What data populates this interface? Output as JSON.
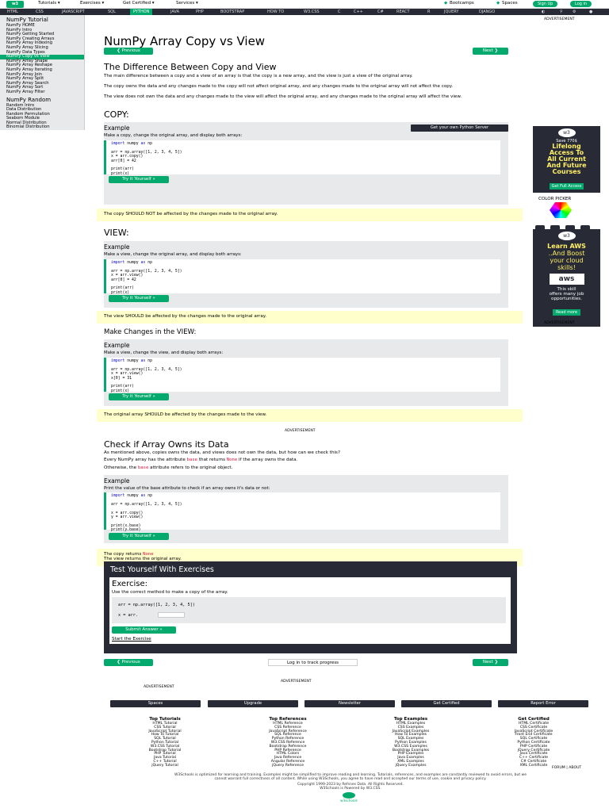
{
  "topbar": {
    "menu": [
      "Tutorials ▾",
      "Exercises ▾",
      "Get Certified ▾",
      "Services ▾"
    ],
    "bootcamp": "Bootcamps",
    "spaces": "Spaces",
    "signup": "Sign Up",
    "login": "Log in"
  },
  "nav": [
    "HTML",
    "CSS",
    "JAVASCRIPT",
    "SQL",
    "PYTHON",
    "JAVA",
    "PHP",
    "BOOTSTRAP",
    "HOW TO",
    "W3.CSS",
    "C",
    "C++",
    "C#",
    "REACT",
    "R",
    "JQUERY",
    "DJANGO"
  ],
  "sidebar": {
    "heading1": "NumPy Tutorial",
    "items1": [
      "NumPy HOME",
      "NumPy Intro",
      "NumPy Getting Started",
      "NumPy Creating Arrays",
      "NumPy Array Indexing",
      "NumPy Array Slicing",
      "NumPy Data Types",
      "NumPy Copy vs View",
      "NumPy Array Shape",
      "NumPy Array Reshape",
      "NumPy Array Iterating",
      "NumPy Array Join",
      "NumPy Array Split",
      "NumPy Array Search",
      "NumPy Array Sort",
      "NumPy Array Filter"
    ],
    "heading2": "NumPy Random",
    "items2": [
      "Random Intro",
      "Data Distribution",
      "Random Permutation",
      "Seaborn Module",
      "Normal Distribution",
      "Binomial Distribution"
    ]
  },
  "main": {
    "title": "NumPy Array Copy vs View",
    "prev": "❮ Previous",
    "next": "Next ❯",
    "diff_heading": "The Difference Between Copy and View",
    "diff_p1": "The main difference between a copy and a view of an array is that the copy is a new array, and the view is just a view of the original array.",
    "diff_p2": "The copy owns the data and any changes made to the copy will not affect original array, and any changes made to the original array will not affect the copy.",
    "diff_p3": "The view does not own the data and any changes made to the view will affect the original array, and any changes made to the original array will affect the view.",
    "copy_heading": "COPY:",
    "example_label": "Example",
    "server_btn": "Get your own Python Server",
    "copy_desc": "Make a copy, change the original array, and display both arrays:",
    "try_btn": "Try it Yourself »",
    "copy_note": "The copy SHOULD NOT be affected by the changes made to the original array.",
    "view_heading": "VIEW:",
    "view_desc": "Make a view, change the original array, and display both arrays:",
    "view_note": "The view SHOULD be affected by the changes made to the original array.",
    "mc_heading": "Make Changes in the VIEW:",
    "mc_desc": "Make a view, change the view, and display both arrays:",
    "mc_note": "The original array SHOULD be affected by the changes made to the view.",
    "advert": "ADVERTISEMENT",
    "own_heading": "Check if Array Owns its Data",
    "own_p1": "As mentioned above, copies owns the data, and views does not own the data, but how can we check this?",
    "own_p2a": "Every NumPy array has the attribute",
    "own_p2_base": "base",
    "own_p2b": "that returns",
    "own_p2_none": "None",
    "own_p2c": "if the array owns the data.",
    "own_p3a": "Otherwise, the",
    "own_p3b": "attribute refers to the original object.",
    "own_desc": "Print the value of the base attribute to check if an array owns it's data or not:",
    "own_note1a": "The copy returns",
    "own_note1_none": "None",
    "own_note2": "The view returns the original array.",
    "track_btn": "Log in to track progress"
  },
  "code": {
    "import": "import",
    "numpy_as": " numpy ",
    "as": "as",
    "np": " np",
    "copy": [
      "arr = np.array([1, 2, 3, 4, 5])",
      "x = arr.copy()",
      "arr[0] = 42",
      "",
      "print(arr)",
      "print(x)"
    ],
    "view": [
      "arr = np.array([1, 2, 3, 4, 5])",
      "x = arr.view()",
      "arr[0] = 42",
      "",
      "print(arr)",
      "print(x)"
    ],
    "mc": [
      "arr = np.array([1, 2, 3, 4, 5])",
      "x = arr.view()",
      "x[0] = 31",
      "",
      "print(arr)",
      "print(x)"
    ],
    "own": [
      "arr = np.array([1, 2, 3, 4, 5])",
      "",
      "x = arr.copy()",
      "y = arr.view()",
      "",
      "print(x.base)",
      "print(y.base)"
    ]
  },
  "exercise": {
    "heading": "Test Yourself With Exercises",
    "label": "Exercise:",
    "desc": "Use the correct method to make a copy of the array.",
    "line1": "arr = np.array([1, 2, 3, 4, 5])",
    "line2": "x = arr.",
    "submit": "Submit Answer »",
    "start": "Start the Exercise"
  },
  "right": {
    "advert": "ADVERTISEMENT",
    "ad1_line1": "Save 770$",
    "ad1_line2": "Lifelong",
    "ad1_line3": "Access To",
    "ad1_line4": "All Current",
    "ad1_line5": "And Future",
    "ad1_line6": "Courses",
    "ad1_btn": "Get Full Access",
    "color_picker": "COLOR PICKER",
    "ad2_line1": "Learn AWS",
    "ad2_line2": "..And Boost",
    "ad2_line3": "your cloud",
    "ad2_line4": "skills!",
    "ad2_aws": "aws",
    "ad2_line5": "This skill",
    "ad2_line6": "offers many job",
    "ad2_line7": "opportunities.",
    "ad2_btn": "Read more",
    "advert2": "ADVERTISEMENT"
  },
  "footer": {
    "advert": "ADVERTISEMENT",
    "advert2": "ADVERTISEMENT",
    "buttons": [
      "Spaces",
      "Upgrade",
      "Newsletter",
      "Get Certified",
      "Report Error"
    ],
    "cols": [
      {
        "title": "Top Tutorials",
        "items": [
          "HTML Tutorial",
          "CSS Tutorial",
          "JavaScript Tutorial",
          "How To Tutorial",
          "SQL Tutorial",
          "Python Tutorial",
          "W3.CSS Tutorial",
          "Bootstrap Tutorial",
          "PHP Tutorial",
          "Java Tutorial",
          "C++ Tutorial",
          "jQuery Tutorial"
        ]
      },
      {
        "title": "Top References",
        "items": [
          "HTML Reference",
          "CSS Reference",
          "JavaScript Reference",
          "SQL Reference",
          "Python Reference",
          "W3.CSS Reference",
          "Bootstrap Reference",
          "PHP Reference",
          "HTML Colors",
          "Java Reference",
          "Angular Reference",
          "jQuery Reference"
        ]
      },
      {
        "title": "Top Examples",
        "items": [
          "HTML Examples",
          "CSS Examples",
          "JavaScript Examples",
          "How To Examples",
          "SQL Examples",
          "Python Examples",
          "W3.CSS Examples",
          "Bootstrap Examples",
          "PHP Examples",
          "Java Examples",
          "XML Examples",
          "jQuery Examples"
        ]
      },
      {
        "title": "Get Certified",
        "items": [
          "HTML Certificate",
          "CSS Certificate",
          "JavaScript Certificate",
          "Front End Certificate",
          "SQL Certificate",
          "Python Certificate",
          "PHP Certificate",
          "jQuery Certificate",
          "Java Certificate",
          "C++ Certificate",
          "C# Certificate",
          "XML Certificate"
        ]
      }
    ],
    "forum": "FORUM | ABOUT",
    "legal1": "W3Schools is optimized for learning and training. Examples might be simplified to improve reading and learning. Tutorials, references, and examples are constantly reviewed to avoid errors, but we",
    "legal2": "cannot warrant full correctness of all content. While using W3Schools, you agree to have read and accepted our terms of use, cookie and privacy policy.",
    "copyright": "Copyright 1999-2023 by Refsnes Data. All Rights Reserved.",
    "powered": "W3Schools is Powered by W3.CSS.",
    "logo_text": "w3schools"
  }
}
